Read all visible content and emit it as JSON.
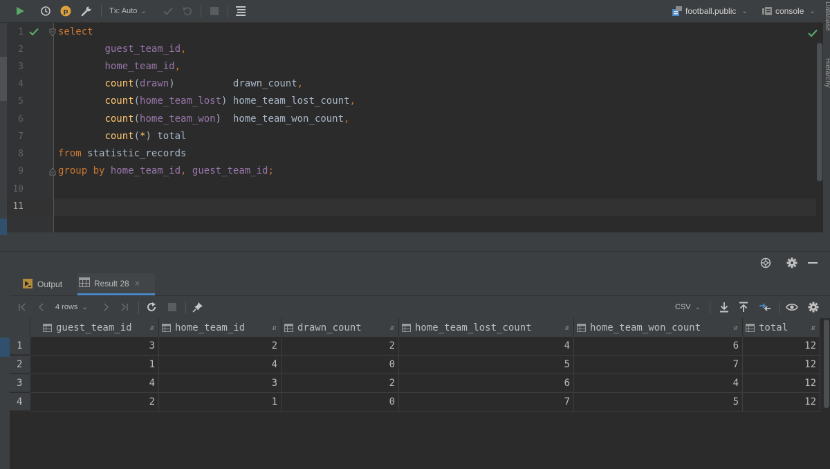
{
  "toolbar": {
    "tx_mode": "Tx: Auto",
    "schema": "football.public",
    "console": "console"
  },
  "side_panels": {
    "top_label": "Database",
    "bottom_label": "Hierarchy"
  },
  "editor": {
    "line_numbers": [
      "1",
      "2",
      "3",
      "4",
      "5",
      "6",
      "7",
      "8",
      "9",
      "10",
      "11"
    ],
    "current_line": "11"
  },
  "tabs": [
    {
      "label": "Output",
      "active": false
    },
    {
      "label": "Result 28",
      "active": true
    }
  ],
  "result_toolbar": {
    "rows_label": "4 rows",
    "export_format": "CSV"
  },
  "grid": {
    "columns": [
      "guest_team_id",
      "home_team_id",
      "drawn_count",
      "home_team_lost_count",
      "home_team_won_count",
      "total"
    ],
    "row_numbers": [
      "1",
      "2",
      "3",
      "4"
    ],
    "rows": [
      [
        "3",
        "2",
        "2",
        "4",
        "6",
        "12"
      ],
      [
        "1",
        "4",
        "0",
        "5",
        "7",
        "12"
      ],
      [
        "4",
        "3",
        "2",
        "6",
        "4",
        "12"
      ],
      [
        "2",
        "1",
        "0",
        "7",
        "5",
        "12"
      ]
    ]
  },
  "colors": {
    "keyword": "#cc7832",
    "function": "#ffc66d",
    "identifier": "#9876aa",
    "plain": "#a9b7c6",
    "success": "#59a869",
    "accent": "#4a88c7"
  },
  "icons": [
    "run-icon",
    "history-icon",
    "profile-icon",
    "settings-wrench-icon",
    "commit-check-icon",
    "rollback-icon",
    "stop-icon",
    "format-icon",
    "database-icon",
    "console-icon",
    "fold-icon",
    "target-icon",
    "gear-icon",
    "minimize-icon",
    "output-icon",
    "table-icon",
    "first-page-icon",
    "prev-page-icon",
    "next-page-icon",
    "last-page-icon",
    "refresh-icon",
    "cancel-icon",
    "pin-icon",
    "download-icon",
    "upload-icon",
    "compare-icon",
    "view-icon",
    "column-icon",
    "sort-icon"
  ]
}
